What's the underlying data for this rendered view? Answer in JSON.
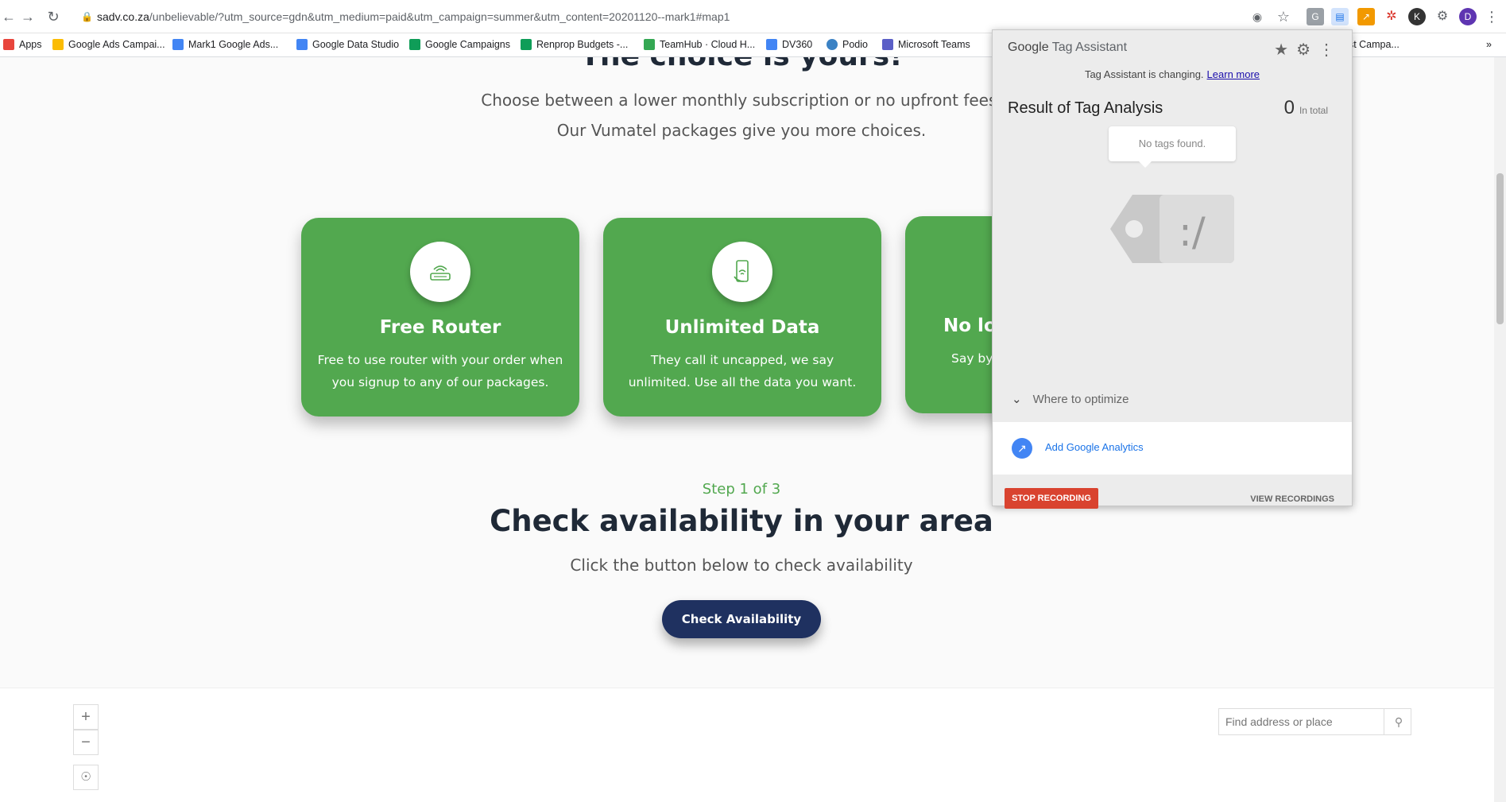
{
  "browser": {
    "url_host": "sadv.co.za",
    "url_path": "/unbelievable/?utm_source=gdn&utm_medium=paid&utm_campaign=summer&utm_content=20201120--mark1#map1",
    "avatar_letter": "D"
  },
  "bookmarks": [
    {
      "label": "Apps",
      "color": "#e8453c"
    },
    {
      "label": "Google Ads Campai...",
      "color": "#fbbc04"
    },
    {
      "label": "Mark1 Google Ads...",
      "color": "#4285f4"
    },
    {
      "label": "Google Data Studio",
      "color": "#4285f4"
    },
    {
      "label": "Google Campaigns",
      "color": "#0f9d58"
    },
    {
      "label": "Renprop Budgets -...",
      "color": "#0f9d58"
    },
    {
      "label": "TeamHub · Cloud H...",
      "color": "#34a853"
    },
    {
      "label": "DV360",
      "color": "#4285f4"
    },
    {
      "label": "Podio",
      "color": "#3b82c4"
    },
    {
      "label": "Microsoft Teams",
      "color": "#5b5fc7"
    },
    {
      "label": "ost Campa...",
      "color": "#0f9d58"
    }
  ],
  "page": {
    "headline": "The choice is yours!",
    "subline1": "Choose between a lower monthly subscription or no upfront fees.",
    "subline2": "Our Vumatel packages give you more choices.",
    "cards": [
      {
        "title": "Free Router",
        "text": "Free to use router with your order when you signup to any of our packages."
      },
      {
        "title": "Unlimited Data",
        "text": "They call it uncapped, we say unlimited. Use all the data you want."
      },
      {
        "title": "No lon",
        "text": "Say bye"
      }
    ],
    "step": "Step 1 of 3",
    "check_title": "Check availability in your area",
    "check_sub": "Click the button below to check availability",
    "check_button": "Check Availability",
    "accent": "#52a84f",
    "button_color": "#1f3160"
  },
  "map": {
    "zoom_in": "+",
    "zoom_out": "−",
    "search_placeholder": "Find address or place"
  },
  "tag_assistant": {
    "brand_google": "Google",
    "brand_name": "Tag Assistant",
    "changing_text": "Tag Assistant is changing.",
    "learn_more": "Learn more",
    "result_title": "Result of Tag Analysis",
    "count": "0",
    "count_label": "In total",
    "no_tags": "No tags found.",
    "optimize_label": "Where to optimize",
    "add_ga": "Add Google Analytics",
    "stop_recording": "STOP RECORDING",
    "view_recordings": "VIEW RECORDINGS"
  }
}
